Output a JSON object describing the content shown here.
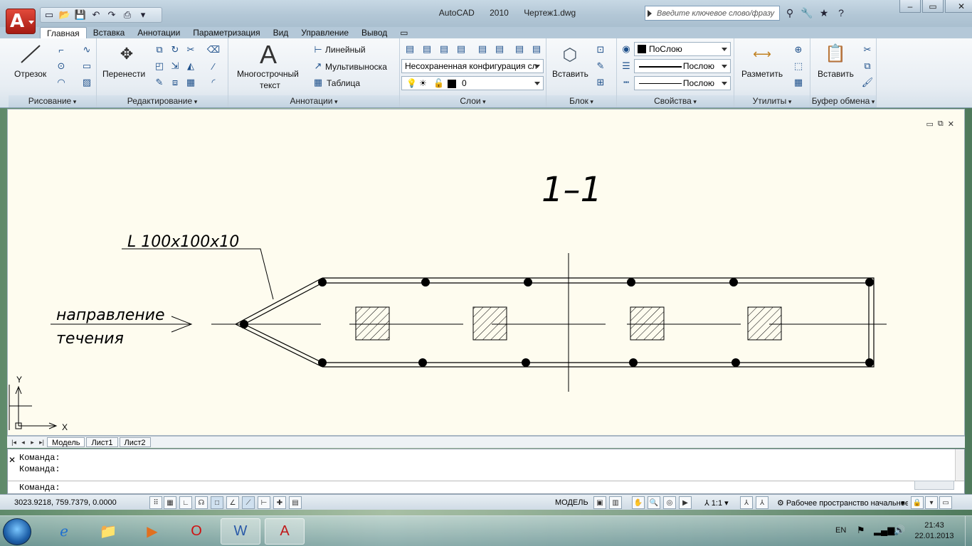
{
  "window": {
    "app_name": "AutoCAD 2010",
    "document": "Чертеж1.dwg"
  },
  "app_button": {
    "glyph": "A"
  },
  "search": {
    "placeholder": "Введите ключевое слово/фразу"
  },
  "tabs": [
    "Главная",
    "Вставка",
    "Аннотации",
    "Параметризация",
    "Вид",
    "Управление",
    "Вывод"
  ],
  "ribbon": {
    "draw": {
      "title": "Рисование",
      "line": "Отрезок"
    },
    "modify": {
      "title": "Редактирование",
      "move": "Перенести"
    },
    "annotation": {
      "title": "Аннотации",
      "mtext_1": "Многострочный",
      "mtext_2": "текст",
      "linear": "Линейный",
      "mleader": "Мультивыноска",
      "table": "Таблица"
    },
    "layers": {
      "title": "Слои",
      "state": "Несохраненная конфигурация сл",
      "current": "0"
    },
    "block": {
      "title": "Блок",
      "insert": "Вставить"
    },
    "properties": {
      "title": "Свойства",
      "color": "ПоСлою",
      "linetype": "Послою",
      "lineweight": "Послою"
    },
    "utilities": {
      "title": "Утилиты",
      "measure": "Разметить"
    },
    "clipboard": {
      "title": "Буфер обмена",
      "paste": "Вставить"
    }
  },
  "drawing": {
    "section_title": "1–1",
    "profile_label": "L  100x100x10",
    "flow_line1": "направление",
    "flow_line2": "течения",
    "ucs_x": "X",
    "ucs_y": "Y"
  },
  "layout_tabs": [
    "Модель",
    "Лист1",
    "Лист2"
  ],
  "command": {
    "lines": [
      "Команда:",
      "Команда:"
    ],
    "prompt": "Команда:"
  },
  "status": {
    "coords": "3023.9218, 759.7379, 0.0000",
    "model": "МОДЕЛЬ",
    "scale": "1:1",
    "workspace": "Рабочее пространство начальное"
  },
  "tray": {
    "lang": "EN",
    "time": "21:43",
    "date": "22.01.2013"
  }
}
